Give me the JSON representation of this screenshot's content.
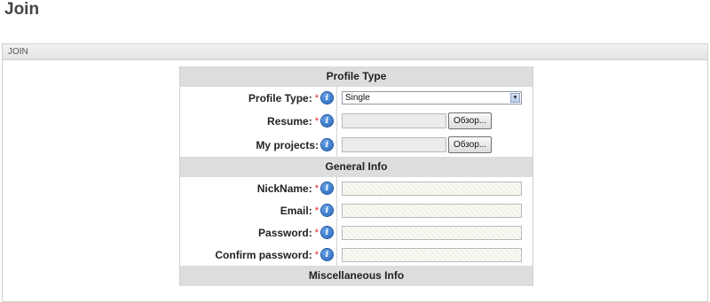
{
  "page": {
    "title": "Join"
  },
  "panel": {
    "header": "JOIN"
  },
  "sections": {
    "profile_type": "Profile Type",
    "general_info": "General Info",
    "misc_info": "Miscellaneous Info"
  },
  "fields": {
    "profile_type": {
      "label": "Profile Type:",
      "value": "Single",
      "required": "*"
    },
    "resume": {
      "label": "Resume:",
      "required": "*",
      "button": "Обзор..."
    },
    "my_projects": {
      "label": "My projects:",
      "button": "Обзор..."
    },
    "nickname": {
      "label": "NickName:",
      "required": "*",
      "value": ""
    },
    "email": {
      "label": "Email:",
      "required": "*",
      "value": ""
    },
    "password": {
      "label": "Password:",
      "required": "*",
      "value": ""
    },
    "confirm_password": {
      "label": "Confirm password:",
      "required": "*",
      "value": ""
    }
  },
  "icons": {
    "info": "info-icon",
    "dropdown": "chevron-down-icon"
  },
  "colors": {
    "required": "#dd2222",
    "info_icon": "#1b5fb8",
    "section_bg": "#dddddd"
  }
}
